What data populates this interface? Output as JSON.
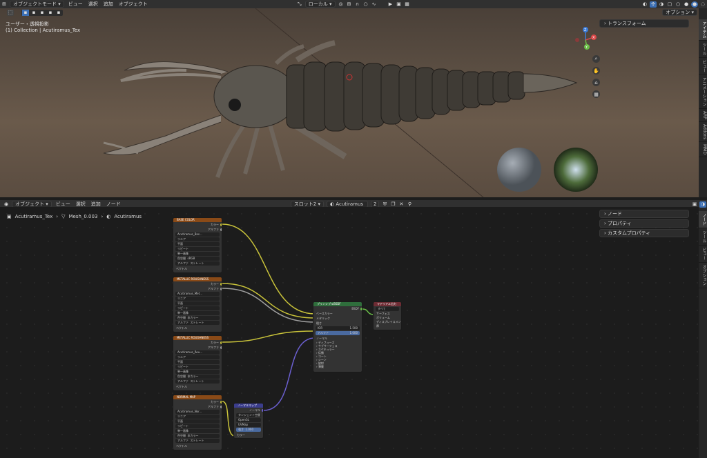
{
  "top_menu": {
    "mode": "オブジェクトモード",
    "items": [
      "ビュー",
      "選択",
      "追加",
      "オブジェクト"
    ],
    "transform": "ローカル",
    "options": "オプション"
  },
  "viewport": {
    "view_name": "ユーザー・透視投影",
    "collection": "(1) Collection | Acutiramus_Tex",
    "transform_panel": "トランスフォーム",
    "right_tabs": [
      "アイテム",
      "ツール",
      "ビュー",
      "アニメーション",
      "ARP",
      "Addons",
      "MMD"
    ]
  },
  "gizmo": {
    "x": "X",
    "y": "Y",
    "z": "Z"
  },
  "node_header": {
    "mode": "オブジェクト",
    "items": [
      "ビュー",
      "選択",
      "追加",
      "ノード"
    ],
    "slot": "スロット2",
    "material": "Acutiramus",
    "users": "2"
  },
  "breadcrumb": [
    "Acutiramus_Tex",
    "Mesh_0.003",
    "Acutiramus"
  ],
  "side_panels": [
    "ノード",
    "プロパティ",
    "カスタムプロパティ"
  ],
  "node_tabs": [
    "ノード",
    "ツール",
    "ビュー",
    "オプション"
  ],
  "tex_rows": [
    "リニア",
    "平面",
    "リピート",
    "単一画像"
  ],
  "nodes": {
    "base": {
      "title": "BASE COLOR",
      "out1": "カラー",
      "out2": "アルファ",
      "img": "Acutiramus_Bas...",
      "cs_label": "色空間",
      "cs": "sRGB",
      "alpha_label": "アルファ",
      "alpha": "ストレート",
      "vec": "ベクトル"
    },
    "metal": {
      "title": "METALLIC ROUGHNESS",
      "out1": "カラー",
      "out2": "アルファ",
      "img": "Acutiramus_Met...",
      "cs_label": "色空間",
      "cs": "非カラー",
      "alpha_label": "アルファ",
      "alpha": "ストレート",
      "vec": "ベクトル"
    },
    "metal2": {
      "title": "METALLIC ROUGHNESS",
      "out1": "カラー",
      "out2": "アルファ",
      "img": "Acutiramus_Rou...",
      "cs_label": "色空間",
      "cs": "非カラー",
      "alpha_label": "アルファ",
      "alpha": "ストレート",
      "vec": "ベクトル"
    },
    "normal": {
      "title": "NORMAL MAP",
      "out1": "カラー",
      "out2": "アルファ",
      "img": "Acutiramus_Nor...",
      "cs_label": "色空間",
      "cs": "非カラー",
      "alpha_label": "アルファ",
      "alpha": "ストレート",
      "vec": "ベクトル"
    },
    "nmap": {
      "title": "ノーマルマップ",
      "out": "ノーマル",
      "space": "タンジェント空間",
      "alg": "OpenGL",
      "uv": "UVMap",
      "str_label": "強さ",
      "str": "1.000",
      "color": "カラー"
    },
    "bsdf": {
      "title": "プリンシプルBSDF",
      "out": "BSDF",
      "in": [
        "ベースカラー",
        "メタリック",
        "粗さ"
      ],
      "ior_label": "IOR",
      "ior": "1.500",
      "alpha_label": "アルファ",
      "alpha": "1.000",
      "normal": "ノーマル",
      "sub": [
        "ディフューズ",
        "サブサーフェス",
        "スペキュラー",
        "伝播",
        "コート",
        "シーン",
        "放射",
        "薄膜"
      ]
    },
    "out": {
      "title": "マテリアル出力",
      "target": "すべて",
      "in": [
        "サーフェス",
        "ボリューム",
        "ディスプレイスメント",
        "厚"
      ]
    }
  },
  "colors": {
    "tex_header": "#8a4a17",
    "bsdf_header": "#2f6e3c",
    "out_header": "#6e2c34",
    "nmap_header": "#3b3d8c",
    "yellow": "#c9c33a",
    "gray": "#a0a0a0",
    "purple": "#6b5fd0"
  }
}
